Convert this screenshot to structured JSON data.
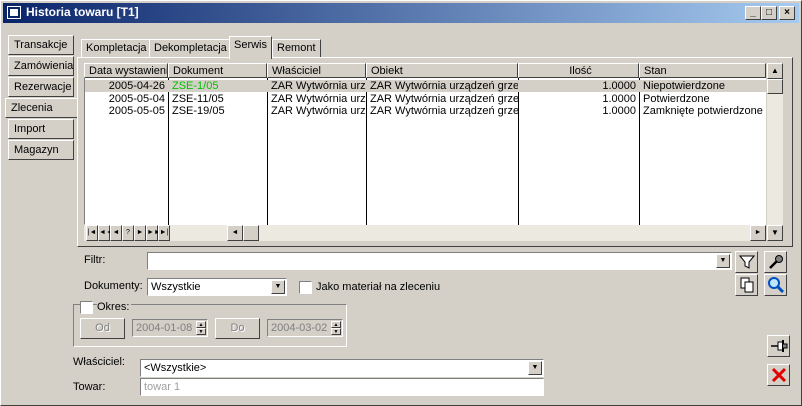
{
  "window": {
    "title": "Historia towaru [T1]",
    "controls": {
      "minimize": "_",
      "maximize": "□",
      "close": "×"
    }
  },
  "side_tabs": [
    {
      "label": "Transakcje",
      "active": false
    },
    {
      "label": "Zamówienia",
      "active": false
    },
    {
      "label": "Rezerwacje",
      "active": false
    },
    {
      "label": "Zlecenia",
      "active": true
    },
    {
      "label": "Import",
      "active": false
    },
    {
      "label": "Magazyn",
      "active": false
    }
  ],
  "top_tabs": [
    {
      "label": "Kompletacja",
      "active": false
    },
    {
      "label": "Dekompletacja",
      "active": false
    },
    {
      "label": "Serwis",
      "active": true
    },
    {
      "label": "Remont",
      "active": false
    }
  ],
  "table": {
    "columns": [
      "Data wystawienia",
      "Dokument",
      "Właściciel",
      "Obiekt",
      "Ilość",
      "Stan"
    ],
    "rows": [
      {
        "date": "2005-04-26",
        "doc": "ZSE-1/05",
        "owner": "ZAR Wytwórnia urządzeń",
        "object": "ZAR Wytwórnia urządzeń grzew",
        "qty": "1.0000",
        "state": "Niepotwierdzone",
        "selected": true
      },
      {
        "date": "2005-05-04",
        "doc": "ZSE-11/05",
        "owner": "ZAR Wytwórnia urządzeń",
        "object": "ZAR Wytwórnia urządzeń grzew",
        "qty": "1.0000",
        "state": "Potwierdzone",
        "selected": false
      },
      {
        "date": "2005-05-05",
        "doc": "ZSE-19/05",
        "owner": "ZAR Wytwórnia urządzeń",
        "object": "ZAR Wytwórnia urządzeń grzew",
        "qty": "1.0000",
        "state": "Zamknięte potwierdzone",
        "selected": false
      }
    ],
    "selected_doc_color": "#00c000"
  },
  "nav_buttons": [
    "|◄",
    "◄◄",
    "◄",
    "?",
    "►",
    "►►",
    "►|"
  ],
  "filter": {
    "label": "Filtr:",
    "value": ""
  },
  "documents": {
    "label": "Dokumenty:",
    "value": "Wszystkie"
  },
  "material_checkbox": {
    "label": "Jako materiał na zleceniu",
    "checked": false
  },
  "period": {
    "label": "Okres:",
    "checked": false,
    "from_label": "Od",
    "from_value": "2004-01-08",
    "to_label": "Do",
    "to_value": "2004-03-02"
  },
  "owner": {
    "label": "Właściciel:",
    "value": "<Wszystkie>"
  },
  "product": {
    "label": "Towar:",
    "placeholder": "towar 1"
  },
  "colors": {
    "title_start": "#0a246a",
    "title_end": "#a6caf0",
    "close_red": "#e00000",
    "selection": "#d4d0c8"
  }
}
